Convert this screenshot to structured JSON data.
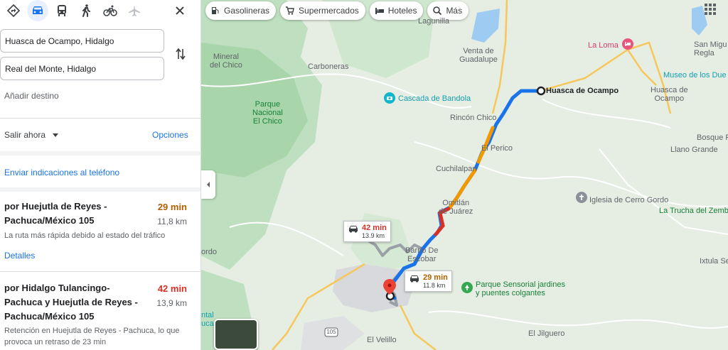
{
  "sidebar": {
    "modes": [
      {
        "icon": "directions-icon",
        "name": "Directions"
      },
      {
        "icon": "car-icon",
        "name": "Car"
      },
      {
        "icon": "transit-icon",
        "name": "Transit"
      },
      {
        "icon": "walking-icon",
        "name": "Walk"
      },
      {
        "icon": "bicycle-icon",
        "name": "Bike"
      },
      {
        "icon": "flight-icon",
        "name": "Flights"
      }
    ],
    "origin": "Huasca de Ocampo, Hidalgo",
    "destination": "Real del Monte, Hidalgo",
    "add_destination": "Añadir destino",
    "leave_now": "Salir ahora",
    "options": "Opciones",
    "send_to_phone": "Enviar indicaciones al teléfono",
    "routes": [
      {
        "name": "por Huejutla de Reyes - Pachuca/México 105",
        "time": "29 min",
        "time_color": "#b06000",
        "distance": "11,8 km",
        "description": "La ruta más rápida debido al estado del tráfico",
        "details": "Detalles"
      },
      {
        "name": "por Hidalgo Tulancingo-Pachuca y Huejutla de Reyes - Pachuca/México 105",
        "time": "42 min",
        "time_color": "#d93025",
        "distance": "13,9 km",
        "description": "Retención en Huejutla de Reyes - Pachuca, lo que provoca un retraso de 23 min"
      }
    ]
  },
  "map": {
    "chips": [
      {
        "icon": "gas-station-icon",
        "label": "Gasolineras"
      },
      {
        "icon": "shopping-cart-icon",
        "label": "Supermercados"
      },
      {
        "icon": "hotel-icon",
        "label": "Hoteles"
      },
      {
        "icon": "search-icon",
        "label": "Más"
      }
    ],
    "places": {
      "lagunilla": "Lagunilla",
      "venta": "Venta de\nGuadalupe",
      "la_loma": "La Loma",
      "san_miguel": "San Migu\nRegla",
      "museo": "Museo de los Due",
      "mineral": "Mineral\ndel Chico",
      "carboneras": "Carboneras",
      "parque_nacional": "Parque\nNacional\nEl Chico",
      "cascada": "Cascada de Bandola",
      "huasca_marker": "Huasca de Ocampo",
      "huasca_town": "Huasca de\nOcampo",
      "rincon": "Rincón Chico",
      "el_perico": "El Perico",
      "bosque": "Bosque R",
      "llano": "Llano Grande",
      "cuchilalpan": "Cuchilalpan",
      "iglesia": "Iglesia de Cerro Gordo",
      "trucha": "La Trucha del Zemb",
      "omitlan": "Omitlán\nde Juárez",
      "barrio": "Barrio De\nEscobar",
      "ixtula": "Ixtula Se",
      "ordo": "ordo",
      "sensorial": "Parque Sensorial jardines\ny puentes colgantes",
      "ntal": "ntal\nuca",
      "el_velillo": "El Velillo",
      "el_jilguero": "El Jilguero",
      "highway": "105"
    },
    "route_boxes": [
      {
        "time": "42 min",
        "distance": "13.9 km",
        "color": "#d93025"
      },
      {
        "time": "29 min",
        "distance": "11.8 km",
        "color": "#b06000"
      }
    ]
  }
}
